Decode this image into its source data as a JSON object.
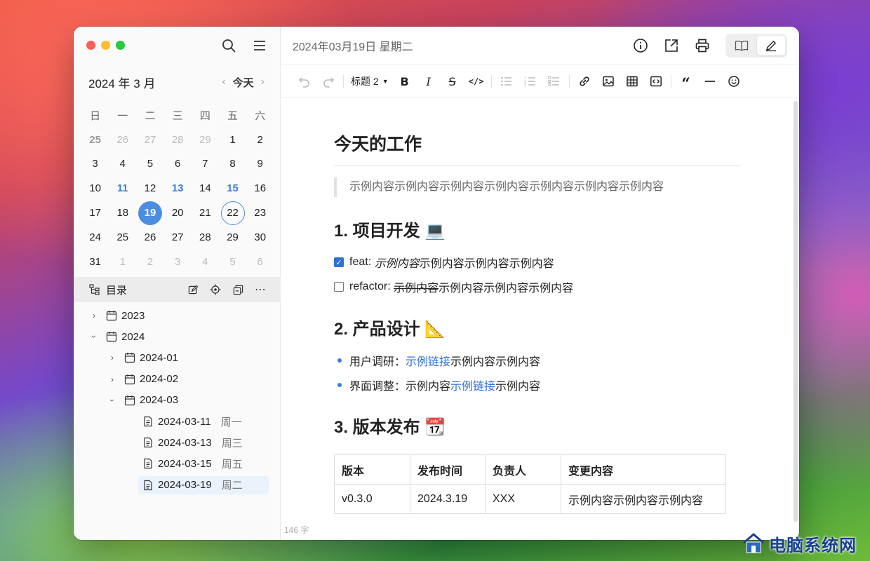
{
  "sidebar": {
    "calendar": {
      "title": "2024 年 3 月",
      "today_label": "今天",
      "weekdays": [
        "日",
        "一",
        "二",
        "三",
        "四",
        "五",
        "六"
      ],
      "weeks": [
        [
          "25",
          "26",
          "27",
          "28",
          "29",
          "1",
          "2"
        ],
        [
          "3",
          "4",
          "5",
          "6",
          "7",
          "8",
          "9"
        ],
        [
          "10",
          "11",
          "12",
          "13",
          "14",
          "15",
          "16"
        ],
        [
          "17",
          "18",
          "19",
          "20",
          "21",
          "22",
          "23"
        ],
        [
          "24",
          "25",
          "26",
          "27",
          "28",
          "29",
          "30"
        ],
        [
          "31",
          "1",
          "2",
          "3",
          "4",
          "5",
          "6"
        ]
      ]
    },
    "toc_label": "目录",
    "tree": {
      "y2023": "2023",
      "y2024": "2024",
      "m01": "2024-01",
      "m02": "2024-02",
      "m03": "2024-03",
      "files": [
        {
          "date": "2024-03-11",
          "weekday": "周一"
        },
        {
          "date": "2024-03-13",
          "weekday": "周三"
        },
        {
          "date": "2024-03-15",
          "weekday": "周五"
        },
        {
          "date": "2024-03-19",
          "weekday": "周二"
        }
      ]
    }
  },
  "topbar": {
    "date_title": "2024年03月19日 星期二"
  },
  "toolbar": {
    "heading_select": "标题 2"
  },
  "doc": {
    "h1": "今天的工作",
    "quote": "示例内容示例内容示例内容示例内容示例内容示例内容示例内容",
    "s1_title": "1. 项目开发 💻",
    "task1_prefix": "feat: ",
    "task1_italic": "示例内容",
    "task1_rest": "示例内容示例内容示例内容",
    "task2_prefix": "refactor: ",
    "task2_strike": "示例内容",
    "task2_rest": "示例内容示例内容示例内容",
    "s2_title": "2. 产品设计 📐",
    "b1_label": "用户调研：",
    "b1_link": "示例链接",
    "b1_rest": "示例内容示例内容",
    "b2_label": "界面调整：",
    "b2_pre": "示例内容",
    "b2_link": "示例链接",
    "b2_rest": "示例内容",
    "s3_title": "3. 版本发布 📆",
    "table": {
      "headers": [
        "版本",
        "发布时间",
        "负责人",
        "变更内容"
      ],
      "row": [
        "v0.3.0",
        "2024.3.19",
        "XXX",
        "示例内容示例内容示例内容"
      ]
    }
  },
  "status": {
    "word_count": "146 字"
  },
  "watermark": {
    "text": "电脑系统网"
  },
  "colors": {
    "accent": "#4a8ee0",
    "link": "#2f6fd8",
    "marked_day": "#3d7fcf"
  }
}
